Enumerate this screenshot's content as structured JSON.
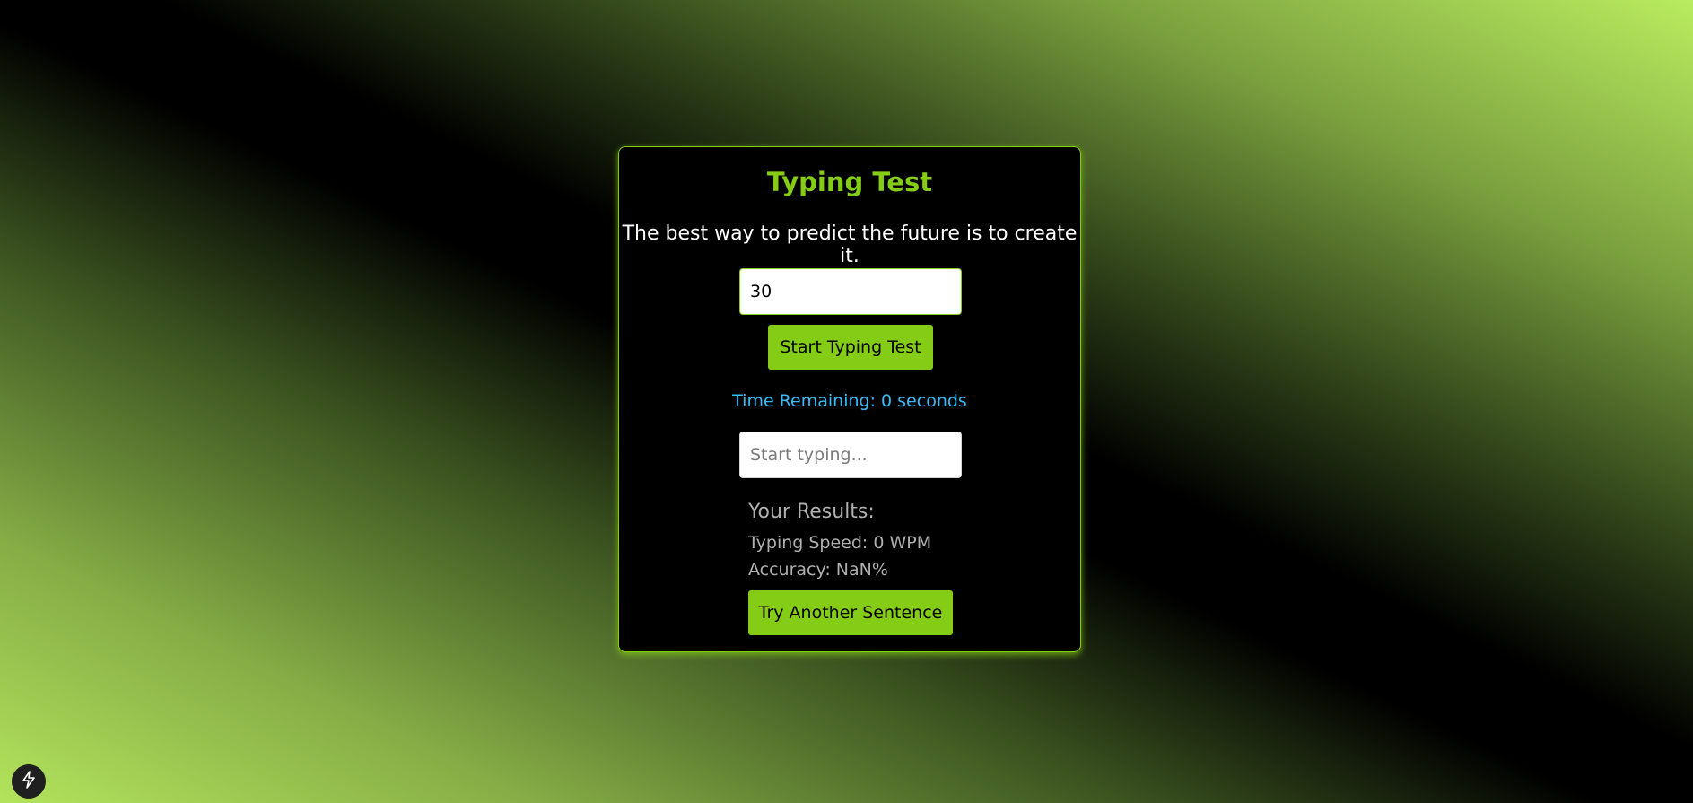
{
  "app": {
    "title": "Typing Test",
    "sentence": "The best way to predict the future is to create it."
  },
  "controls": {
    "time_value": "30",
    "start_label": "Start Typing Test",
    "timer_text": "Time Remaining: 0 seconds",
    "typing_placeholder": "Start typing...",
    "typing_value": ""
  },
  "results": {
    "heading": "Your Results:",
    "speed": "Typing Speed: 0 WPM",
    "accuracy": "Accuracy: NaN%",
    "retry_label": "Try Another Sentence"
  },
  "colors": {
    "accent": "#84cc16",
    "timer": "#38bdf8",
    "card_background": "#000000"
  },
  "icons": {
    "corner_badge": "lightning-bolt-icon"
  }
}
